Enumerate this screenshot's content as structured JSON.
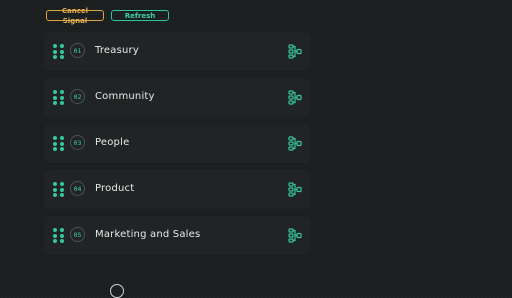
{
  "toolbar": {
    "cancel_label": "Cancel Signal",
    "refresh_label": "Refresh"
  },
  "items": [
    {
      "number": "01",
      "label": "Treasury"
    },
    {
      "number": "02",
      "label": "Community"
    },
    {
      "number": "03",
      "label": "People"
    },
    {
      "number": "04",
      "label": "Product"
    },
    {
      "number": "05",
      "label": "Marketing and Sales"
    }
  ],
  "icons": {
    "drag_handle": "drag-handle-icon",
    "node": "node-graph-icon"
  },
  "colors": {
    "accent": "#36c79a",
    "warning": "#d9a441",
    "background": "#1c1f1f",
    "row": "#202424"
  }
}
